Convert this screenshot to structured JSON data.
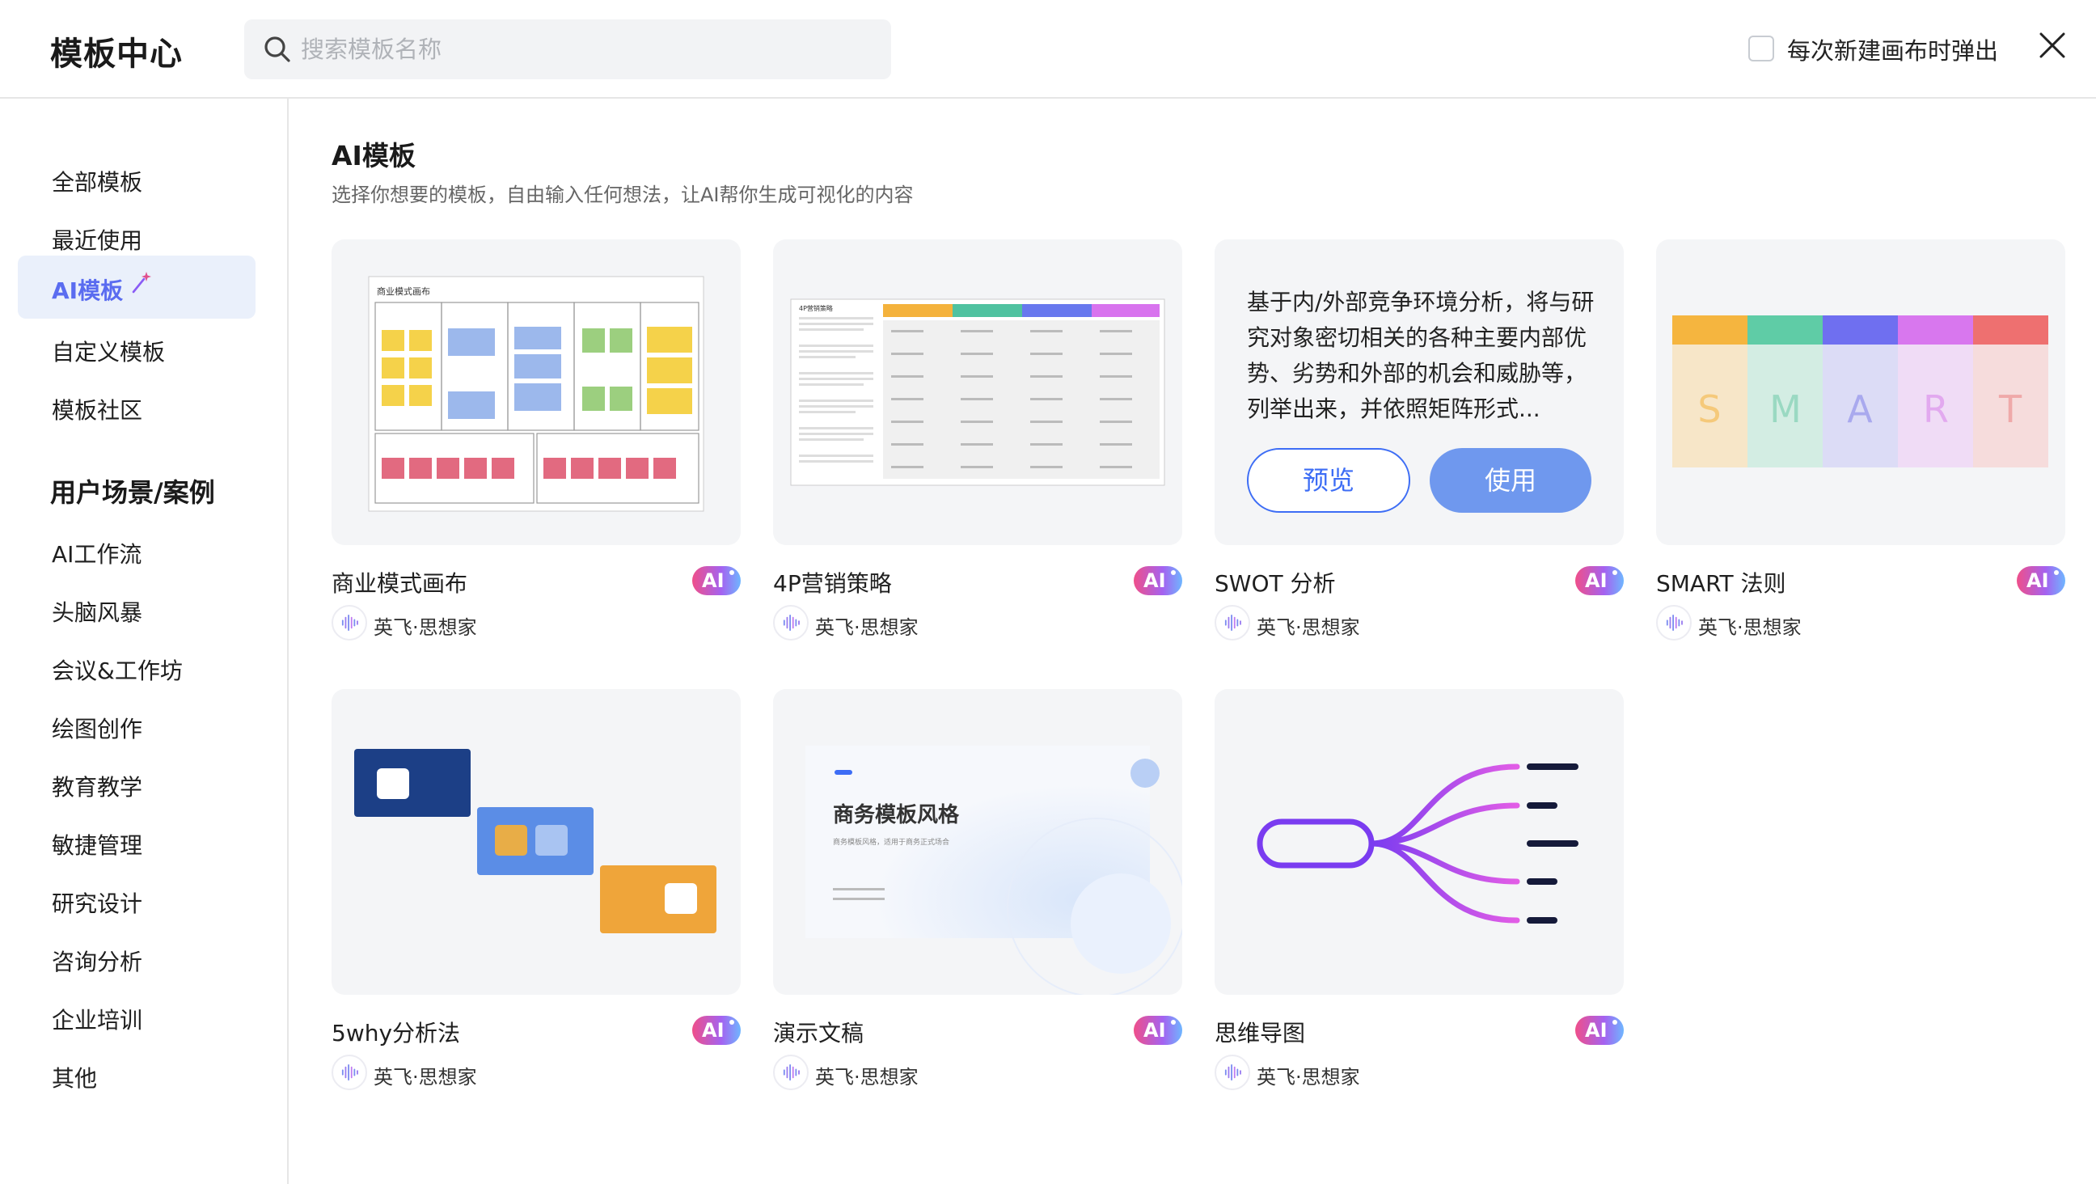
{
  "header": {
    "title": "模板中心",
    "search_placeholder": "搜索模板名称",
    "popup_label": "每次新建画布时弹出",
    "popup_checked": false
  },
  "sidebar": {
    "items": [
      {
        "label": "全部模板"
      },
      {
        "label": "最近使用"
      },
      {
        "label": "AI模板",
        "active": true
      },
      {
        "label": "自定义模板"
      },
      {
        "label": "模板社区"
      }
    ],
    "scenes_heading": "用户场景/案例",
    "scenes": [
      "AI工作流",
      "头脑风暴",
      "会议&工作坊",
      "绘图创作",
      "教育教学",
      "敏捷管理",
      "研究设计",
      "咨询分析",
      "企业培训",
      "其他"
    ]
  },
  "main": {
    "title": "AI模板",
    "subtitle": "选择你想要的模板，自由输入任何想法，让AI帮你生成可视化的内容",
    "badge_text": "AI",
    "cards": [
      {
        "name": "商业模式画布",
        "author": "英飞·思想家",
        "preview_title": "商业模式画布"
      },
      {
        "name": "4P营销策略",
        "author": "英飞·思想家",
        "preview_title": "4P营销策略"
      },
      {
        "name": "SWOT 分析",
        "author": "英飞·思想家",
        "hover_text": "基于内/外部竞争环境分析，将与研究对象密切相关的各种主要内部优势、劣势和外部的机会和威胁等，列举出来，并依照矩阵形式...",
        "preview_button": "预览",
        "use_button": "使用"
      },
      {
        "name": "SMART 法则",
        "author": "英飞·思想家",
        "letters": [
          "S",
          "M",
          "A",
          "R",
          "T"
        ]
      },
      {
        "name": "5why分析法",
        "author": "英飞·思想家"
      },
      {
        "name": "演示文稿",
        "author": "英飞·思想家",
        "preview_title": "商务模板风格",
        "preview_sub": "商务模板风格，适用于商务正式场合"
      },
      {
        "name": "思维导图",
        "author": "英飞·思想家"
      }
    ]
  },
  "colors": {
    "accent": "#3d6df5",
    "active_bg": "#eaf0fb",
    "use_button": "#6f98ee",
    "smart": [
      "#f5b53f",
      "#5fcca6",
      "#6f6ff0",
      "#d877ee",
      "#ee7070"
    ]
  }
}
